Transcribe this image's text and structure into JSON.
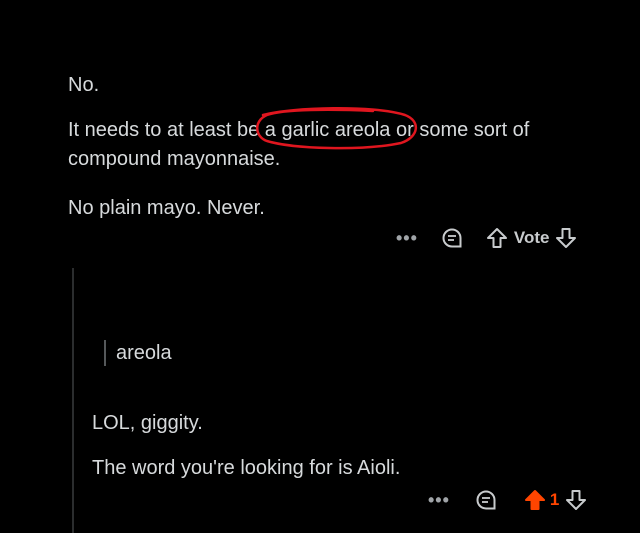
{
  "parent_comment": {
    "lines": {
      "p1": "No.",
      "p2_pre": "It needs to at least be ",
      "p2_circled": "a garlic areola",
      "p2_post": " or some sort of",
      "p2_line2": "compound mayonnaise.",
      "p3": "No plain mayo. Never."
    },
    "actions": {
      "more_label": "•••",
      "vote_label": "Vote"
    }
  },
  "reply_comment": {
    "quote": "areola",
    "p1": "LOL, giggity.",
    "p2": "The word you're looking for is Aioli.",
    "actions": {
      "more_label": "•••",
      "vote_count": "1"
    }
  },
  "colors": {
    "background": "#000000",
    "text": "#d7dadc",
    "upvote_active": "#ff4500",
    "circle_annotation": "#e0161f"
  },
  "icons": [
    "more-icon",
    "reply-icon",
    "upvote-icon",
    "downvote-icon"
  ]
}
